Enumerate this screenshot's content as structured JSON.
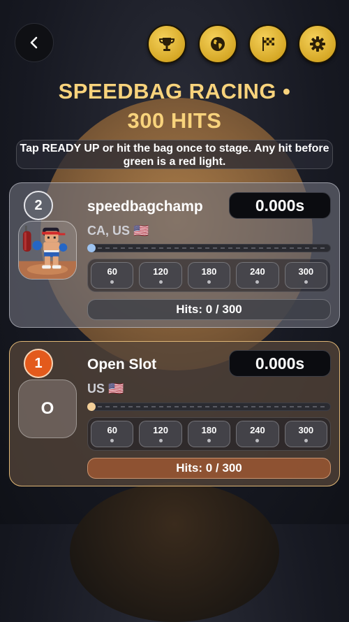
{
  "header": {
    "title_line1": "SPEEDBAG RACING •",
    "title_line2": "300 HITS",
    "instructions": "Tap READY UP or hit the bag once to stage. Any hit before green is a red light.",
    "icons": [
      "back-chevron-icon",
      "trophy-icon",
      "globe-icon",
      "checkered-flag-icon",
      "gear-icon"
    ]
  },
  "racers": [
    {
      "rank": "2",
      "name": "speedbagchamp",
      "time": "0.000s",
      "location": "CA, US 🇺🇸",
      "progress": 0,
      "checkpoints": [
        "60",
        "120",
        "180",
        "240",
        "300"
      ],
      "hits": "Hits: 0 / 300",
      "knob_color": "#9ec3f0"
    },
    {
      "rank": "1",
      "name": "Open Slot",
      "avatar_letter": "O",
      "time": "0.000s",
      "location": "US 🇺🇸",
      "progress": 0,
      "checkpoints": [
        "60",
        "120",
        "180",
        "240",
        "300"
      ],
      "hits": "Hits: 0 / 300",
      "knob_color": "#f3cf98"
    }
  ],
  "colors": {
    "accent_gold": "#f8d37c",
    "rank_orange": "#e35a1c"
  }
}
